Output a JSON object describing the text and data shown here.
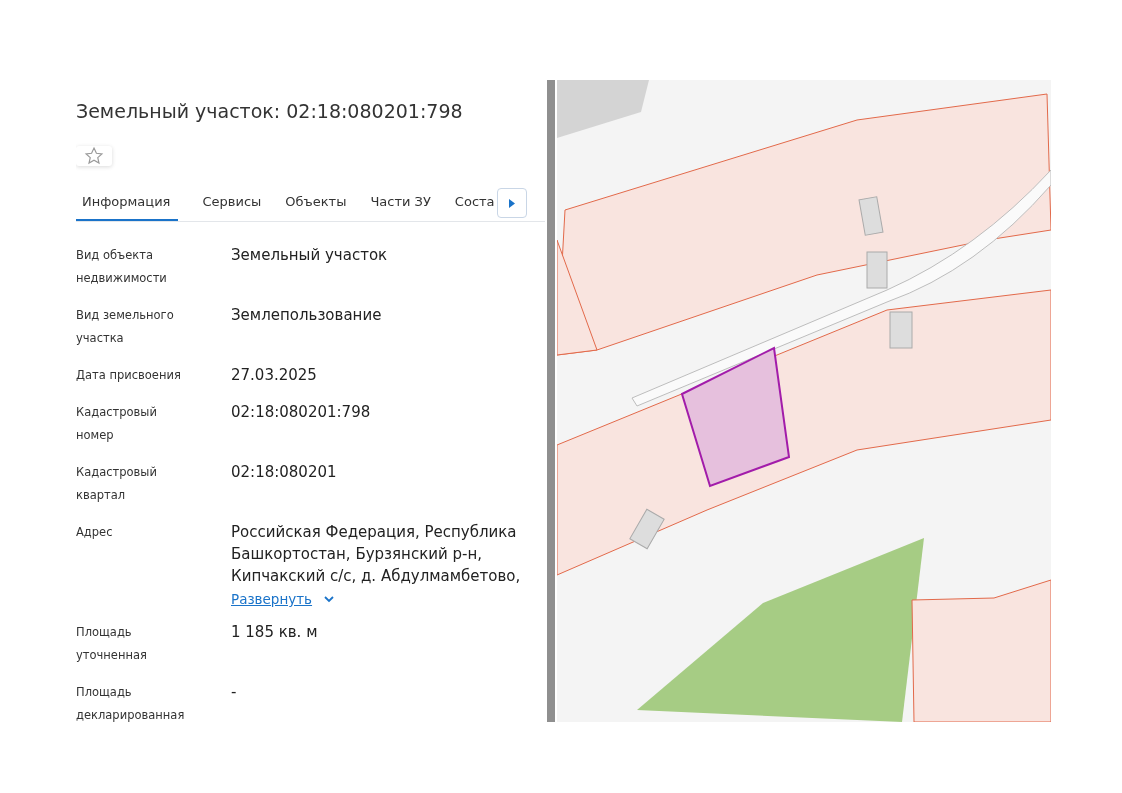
{
  "title": "Земельный участок: 02:18:080201:798",
  "favorite": {
    "selected": false
  },
  "tabs": [
    {
      "label": "Информация",
      "selected": true
    },
    {
      "label": "Сервисы",
      "selected": false
    },
    {
      "label": "Объекты",
      "selected": false
    },
    {
      "label": "Части ЗУ",
      "selected": false
    },
    {
      "label": "Соста",
      "selected": false
    }
  ],
  "fields": [
    {
      "label": "Вид объекта недвижимости",
      "value": "Земельный участок"
    },
    {
      "label": "Вид земельного участка",
      "value": "Землепользование"
    },
    {
      "label": "Дата присвоения",
      "value": "27.03.2025"
    },
    {
      "label": "Кадастровый номер",
      "value": "02:18:080201:798"
    },
    {
      "label": "Кадастровый квартал",
      "value": "02:18:080201"
    },
    {
      "label": "Адрес",
      "value": "Российская Федерация, Республика Башкортостан, Бурзянский р-н, Кипчакский с/с, д. Абдулмамбетово,",
      "expand_link": "Развернуть"
    },
    {
      "label": "Площадь уточненная",
      "value": "1 185 кв. м"
    },
    {
      "label": "Площадь декларированная",
      "value": "-"
    }
  ]
}
